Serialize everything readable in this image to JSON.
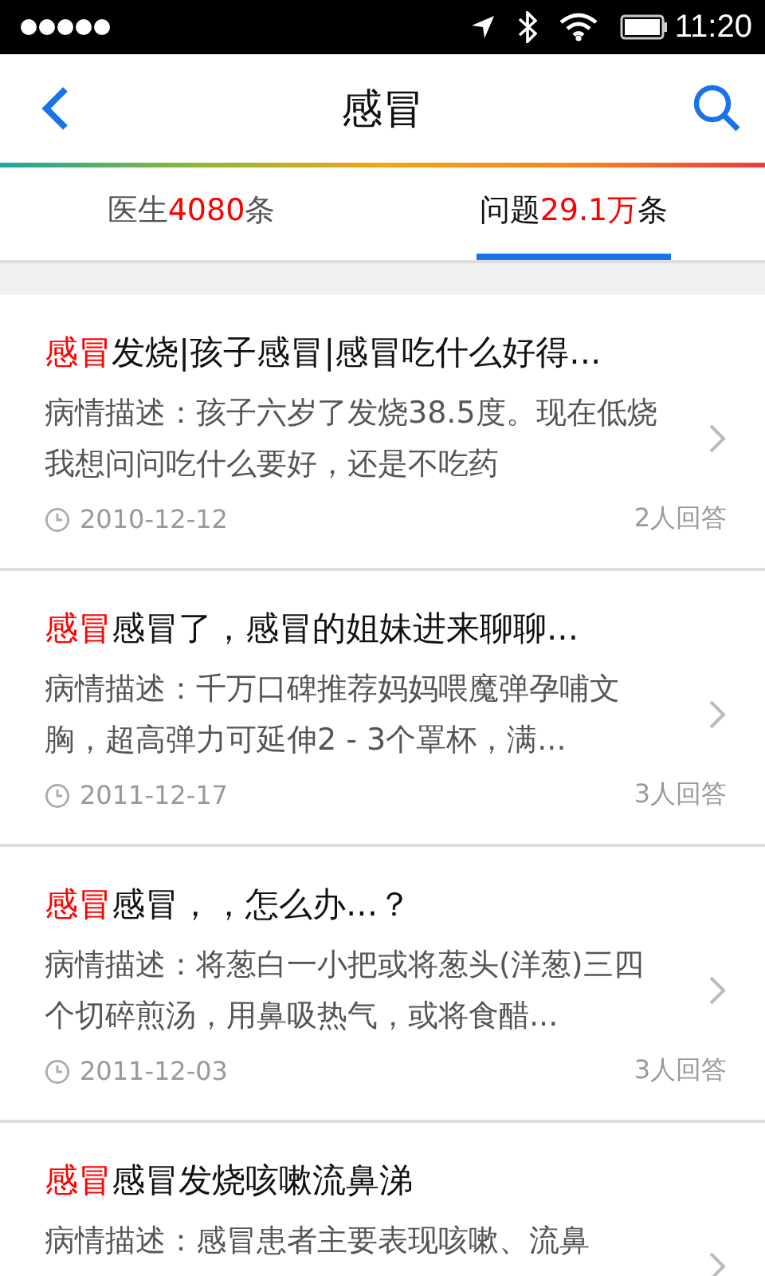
{
  "status_bar": {
    "time": "11:20"
  },
  "nav": {
    "title": "感冒"
  },
  "tabs": [
    {
      "label": "医生",
      "count": "4080",
      "unit": "条",
      "selected": false
    },
    {
      "label": "问题",
      "count": "29.1万",
      "unit": "条",
      "selected": true
    }
  ],
  "questions": [
    {
      "keyword": "感冒",
      "title": "发烧|孩子感冒|感冒吃什么好得...",
      "description": "病情描述：孩子六岁了发烧38.5度。现在低烧我想问问吃什么要好，还是不吃药",
      "date": "2010-12-12",
      "answers": "2人回答"
    },
    {
      "keyword": "感冒",
      "title": "感冒了，感冒的姐妹进来聊聊...",
      "description": "病情描述：千万口碑推荐妈妈喂魔弹孕哺文胸，超高弹力可延伸2 - 3个罩杯，满...",
      "date": "2011-12-17",
      "answers": "3人回答"
    },
    {
      "keyword": "感冒",
      "title": "感冒，，怎么办...？",
      "description": "病情描述：将葱白一小把或将葱头(洋葱)三四个切碎煎汤，用鼻吸热气，或将食醋...",
      "date": "2011-12-03",
      "answers": "3人回答"
    },
    {
      "keyword": "感冒",
      "title": "感冒发烧咳嗽流鼻涕",
      "description": "病情描述：感冒患者主要表现咳嗽、流鼻"
    }
  ]
}
